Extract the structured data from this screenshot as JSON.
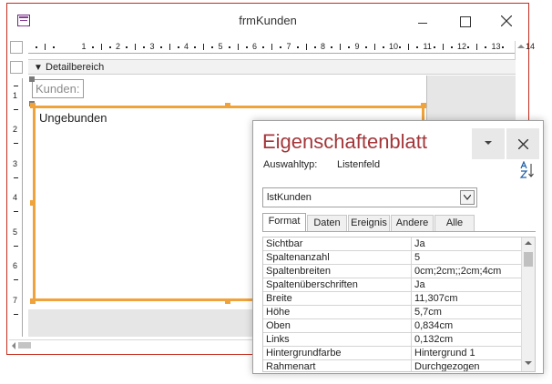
{
  "window": {
    "title": "frmKunden"
  },
  "designer": {
    "section_label": "Detailbereich",
    "ruler_h": [
      "1",
      "2",
      "3",
      "4",
      "5",
      "6",
      "7",
      "8",
      "9",
      "10",
      "11",
      "12",
      "13",
      "14"
    ],
    "ruler_v": [
      "1",
      "2",
      "3",
      "4",
      "5",
      "6",
      "7"
    ],
    "label_text": "Kunden:",
    "listbox_text": "Ungebunden"
  },
  "property_sheet": {
    "title": "Eigenschaftenblatt",
    "selection_type_label": "Auswahltyp:",
    "selection_type_value": "Listenfeld",
    "selected_object": "lstKunden",
    "tabs": [
      "Format",
      "Daten",
      "Ereignis",
      "Andere",
      "Alle"
    ],
    "active_tab": "Format",
    "properties": [
      {
        "name": "Sichtbar",
        "value": "Ja"
      },
      {
        "name": "Spaltenanzahl",
        "value": "5"
      },
      {
        "name": "Spaltenbreiten",
        "value": "0cm;2cm;;2cm;4cm"
      },
      {
        "name": "Spaltenüberschriften",
        "value": "Ja"
      },
      {
        "name": "Breite",
        "value": "11,307cm"
      },
      {
        "name": "Höhe",
        "value": "5,7cm"
      },
      {
        "name": "Oben",
        "value": "0,834cm"
      },
      {
        "name": "Links",
        "value": "0,132cm"
      },
      {
        "name": "Hintergrundfarbe",
        "value": "Hintergrund 1"
      },
      {
        "name": "Rahmenart",
        "value": "Durchgezogen"
      }
    ]
  },
  "colors": {
    "accent_title": "#a4373a",
    "selection_orange": "#f0a33a",
    "window_border": "#c42b1c"
  }
}
